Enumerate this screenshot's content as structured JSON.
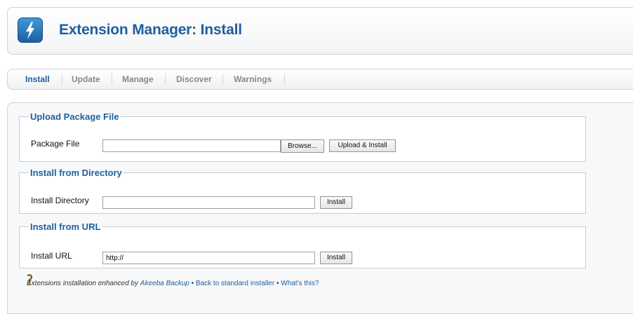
{
  "header": {
    "title": "Extension Manager: Install",
    "icon": "extension-lightning-icon",
    "accent_color": "#1d5f9f"
  },
  "tabs": [
    {
      "label": "Install",
      "active": true
    },
    {
      "label": "Update",
      "active": false
    },
    {
      "label": "Manage",
      "active": false
    },
    {
      "label": "Discover",
      "active": false
    },
    {
      "label": "Warnings",
      "active": false
    }
  ],
  "upload": {
    "legend": "Upload Package File",
    "field_label": "Package File",
    "value": "",
    "browse_label": "Browse...",
    "submit_label": "Upload & Install"
  },
  "directory": {
    "legend": "Install from Directory",
    "field_label": "Install Directory",
    "value": "",
    "submit_label": "Install"
  },
  "url": {
    "legend": "Install from URL",
    "field_label": "Install URL",
    "value": "http://",
    "submit_label": "Install"
  },
  "footer": {
    "icon": "akeeba-info-icon",
    "text_prefix": "Extensions installation enhanced by",
    "akeeba_link": "Akeeba Backup",
    "separator": " • ",
    "standard_link": "Back to standard installer",
    "whats_this_link": "What's this?"
  }
}
